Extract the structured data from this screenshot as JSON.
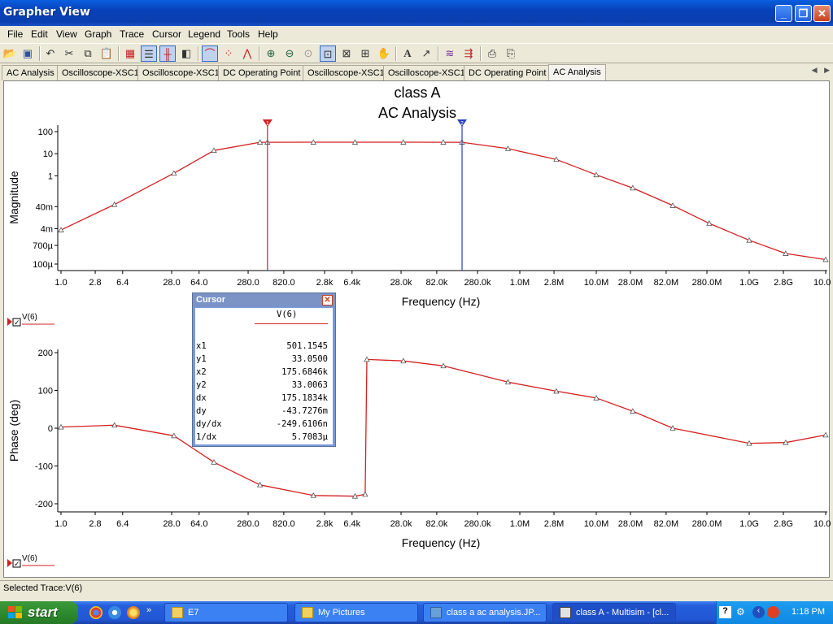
{
  "window": {
    "title": "Grapher View",
    "buttons": {
      "minimize": "_",
      "restore": "❐",
      "close": "✕"
    }
  },
  "menu": [
    "File",
    "Edit",
    "View",
    "Graph",
    "Trace",
    "Cursor",
    "Legend",
    "Tools",
    "Help"
  ],
  "toolbar": [
    "open-icon",
    "save-icon",
    "undo-icon",
    "cut-icon",
    "copy-icon",
    "paste-icon",
    "grid-icon",
    "legend-icon",
    "cursors-icon",
    "reverse-colors-icon",
    "show-select-marks-icon",
    "lines-icon",
    "points-icon",
    "lines-points-icon",
    "zoom-in-icon",
    "zoom-out-icon",
    "zoom-full-icon",
    "zoom-area-icon",
    "zoom-x-icon",
    "zoom-y-icon",
    "pan-icon",
    "text-icon",
    "pointer-icon",
    "overlay-traces-icon",
    "export-icon",
    "print-icon",
    "print-preview-icon"
  ],
  "tabs": [
    "AC Analysis",
    "Oscilloscope-XSC1",
    "Oscilloscope-XSC1",
    "DC Operating Point",
    "Oscilloscope-XSC1",
    "Oscilloscope-XSC1",
    "DC Operating Point",
    "AC Analysis"
  ],
  "active_tab": 7,
  "tab_nav": {
    "left": "◀",
    "right": "▶"
  },
  "graph": {
    "title_line1": "class A",
    "title_line2": "AC Analysis",
    "magnitude_ylabel": "Magnitude",
    "phase_ylabel": "Phase (deg)",
    "xlabel": "Frequency (Hz)",
    "x_ticks": [
      "1.0",
      "2.8",
      "6.4",
      "28.0",
      "64.0",
      "280.0",
      "820.0",
      "2.8k",
      "6.4k",
      "28.0k",
      "82.0k",
      "280.0k",
      "1.0M",
      "2.8M",
      "10.0M",
      "28.0M",
      "82.0M",
      "280.0M",
      "1.0G",
      "2.8G",
      "10.0G"
    ],
    "magnitude_ticks": [
      "100",
      "10",
      "1",
      "40m",
      "4m",
      "700µ",
      "100µ"
    ],
    "phase_ticks": [
      "200",
      "100",
      "0",
      "-100",
      "-200"
    ],
    "legend_label": "V(6)",
    "trace_color": "#d42020",
    "cursor1_color": "#d42020",
    "cursor2_color": "#2a3fbf",
    "cursor1_label": "1",
    "cursor2_label": "2"
  },
  "cursor_window": {
    "title": "Cursor",
    "trace": "V(6)",
    "rows": [
      {
        "key": "x1",
        "value": "501.1545"
      },
      {
        "key": "y1",
        "value": "33.0500"
      },
      {
        "key": "x2",
        "value": "175.6846k"
      },
      {
        "key": "y2",
        "value": "33.0063"
      },
      {
        "key": "dx",
        "value": "175.1834k"
      },
      {
        "key": "dy",
        "value": "-43.7276m"
      },
      {
        "key": "dy/dx",
        "value": "-249.6106n"
      },
      {
        "key": "1/dx",
        "value": "5.7083µ"
      }
    ]
  },
  "chart_data": [
    {
      "type": "line",
      "title": "class A AC Analysis",
      "xlabel": "Frequency (Hz)",
      "ylabel": "Magnitude",
      "x_scale": "log",
      "y_scale": "log",
      "xlim": [
        1,
        10000000000
      ],
      "ylim": [
        0.0001,
        100
      ],
      "grid": false,
      "series": [
        {
          "name": "V(6)",
          "x": [
            1,
            5,
            30,
            100,
            400,
            500,
            2000,
            7000,
            30000,
            100000,
            175000,
            700000,
            3000000,
            10000000,
            30000000,
            100000000,
            300000000,
            1000000000,
            3000000000,
            10000000000
          ],
          "y": [
            0.0035,
            0.05,
            1.3,
            14,
            33,
            33.05,
            33.1,
            33.1,
            33.1,
            33.05,
            33.0,
            17,
            5.5,
            1.1,
            0.28,
            0.045,
            0.007,
            0.0012,
            0.0003,
            0.00016
          ]
        }
      ],
      "cursors": [
        501.1545,
        175684.6
      ]
    },
    {
      "type": "line",
      "xlabel": "Frequency (Hz)",
      "ylabel": "Phase (deg)",
      "x_scale": "log",
      "xlim": [
        1,
        10000000000
      ],
      "ylim": [
        -200,
        200
      ],
      "grid": false,
      "series": [
        {
          "name": "V(6)",
          "x": [
            1,
            5,
            30,
            100,
            400,
            2000,
            7000,
            9500,
            10000,
            30000,
            100000,
            700000,
            3000000,
            10000000,
            30000000,
            100000000,
            1000000000,
            3000000000,
            10000000000
          ],
          "y": [
            3,
            8,
            -20,
            -90,
            -150,
            -178,
            -180,
            -175,
            182,
            178,
            165,
            122,
            98,
            80,
            45,
            0,
            -40,
            -38,
            -18
          ]
        }
      ]
    }
  ],
  "status": "Selected Trace:V(6)",
  "taskbar": {
    "start": "start",
    "tasks": [
      "E7",
      "My Pictures",
      "class a ac analysis.JP...",
      "class A - Multisim - [cl..."
    ],
    "clock": "1:18 PM"
  }
}
